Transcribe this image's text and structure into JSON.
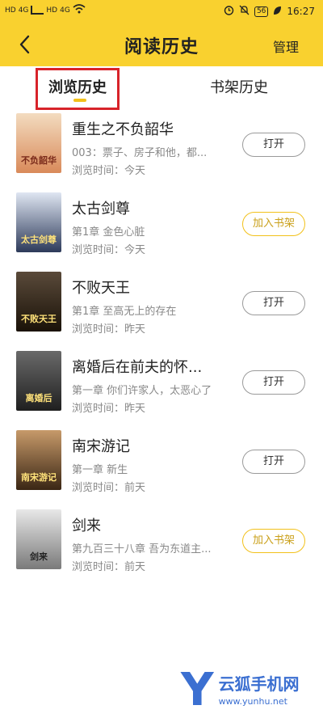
{
  "status_bar": {
    "left_labels": [
      "HD",
      "4G",
      "HD",
      "4G"
    ],
    "time": "16:27",
    "battery": "56"
  },
  "header": {
    "title": "阅读历史",
    "manage_label": "管理"
  },
  "tabs": [
    {
      "label": "浏览历史",
      "active": true
    },
    {
      "label": "书架历史",
      "active": false
    }
  ],
  "books": [
    {
      "title": "重生之不负韶华",
      "chapter": "003：票子、房子和他，都...",
      "time": "浏览时间：今天",
      "button": "打开",
      "button_type": "open",
      "cover_text": "不负韶华",
      "cover_color": "#e9c7a0"
    },
    {
      "title": "太古剑尊",
      "chapter": "第1章 金色心脏",
      "time": "浏览时间：今天",
      "button": "加入书架",
      "button_type": "add",
      "cover_text": "太古剑尊",
      "cover_color": "#2d3a5a"
    },
    {
      "title": "不败天王",
      "chapter": "第1章 至高无上的存在",
      "time": "浏览时间：昨天",
      "button": "打开",
      "button_type": "open",
      "cover_text": "不败天王",
      "cover_color": "#3a2a1a"
    },
    {
      "title": "离婚后在前夫的怀...",
      "chapter": "第一章 你们许家人，太恶心了",
      "time": "浏览时间：昨天",
      "button": "打开",
      "button_type": "open",
      "cover_text": "离婚后",
      "cover_color": "#2b2b2b"
    },
    {
      "title": "南宋游记",
      "chapter": "第一章 新生",
      "time": "浏览时间：前天",
      "button": "打开",
      "button_type": "open",
      "cover_text": "南宋游记",
      "cover_color": "#6b4a2a"
    },
    {
      "title": "剑来",
      "chapter": "第九百三十八章 吾为东道主...",
      "time": "浏览时间：前天",
      "button": "加入书架",
      "button_type": "add",
      "cover_text": "剑来",
      "cover_color": "#cfcfcf"
    }
  ],
  "watermark": {
    "letter": "Y",
    "name": "云狐手机网",
    "url": "www.yunhu.net"
  },
  "colors": {
    "header_bg": "#f9d12f",
    "accent": "#f2c11a",
    "highlight": "#d8232a"
  }
}
